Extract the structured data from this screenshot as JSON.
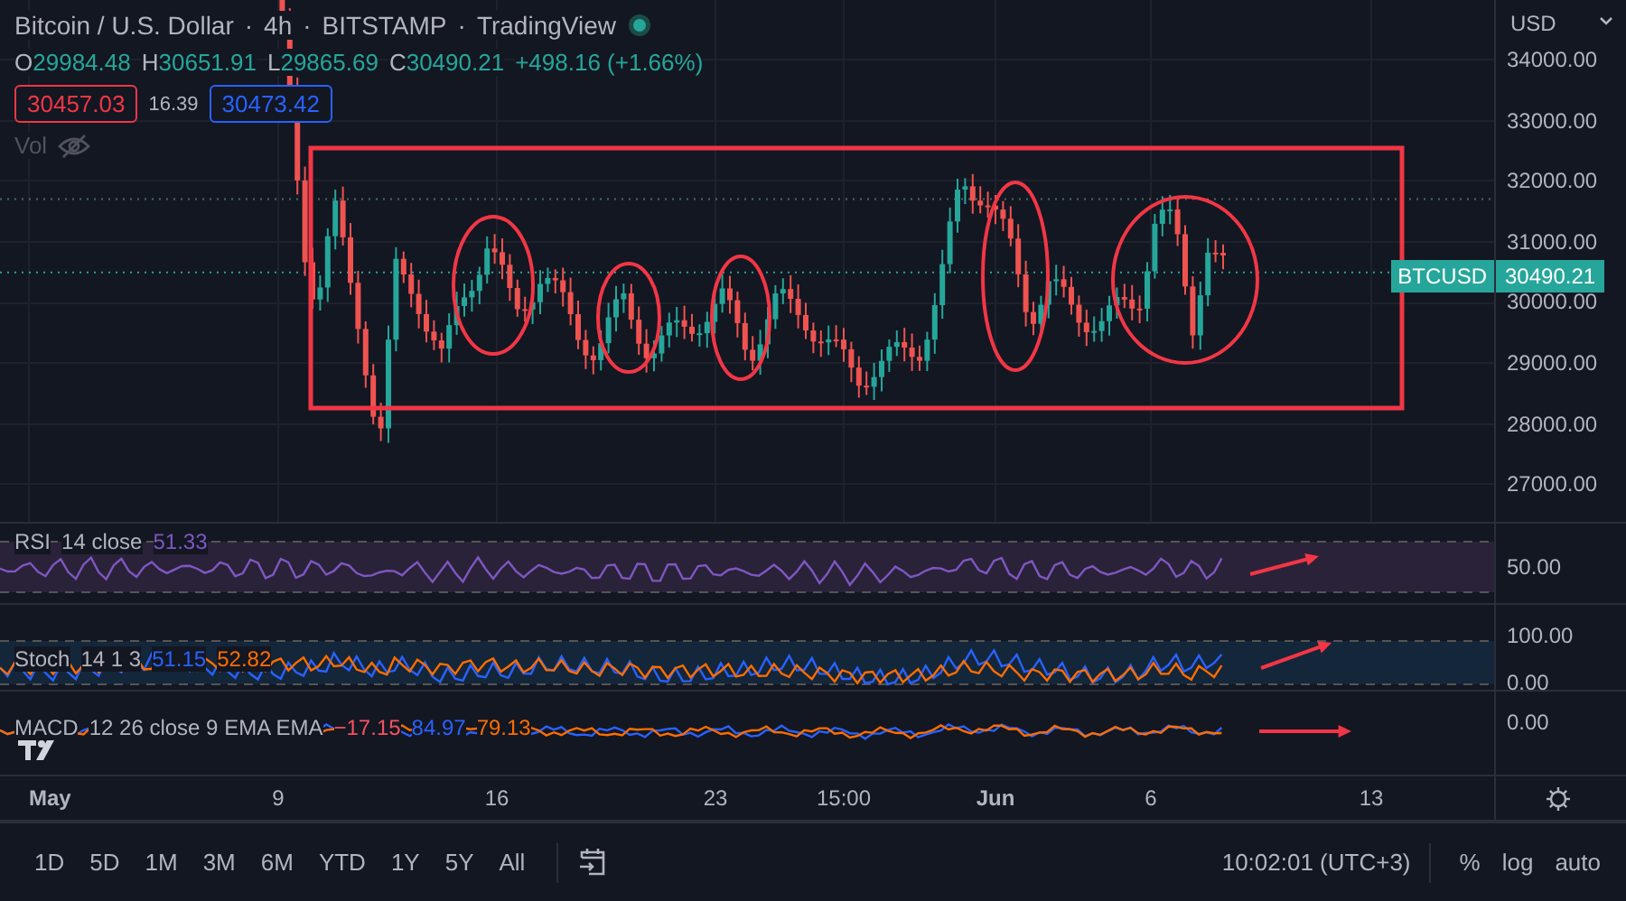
{
  "symbol": {
    "title": "Bitcoin / U.S. Dollar",
    "interval": "4h",
    "exchange": "BITSTAMP",
    "source": "TradingView",
    "separators": [
      "·",
      "·",
      "·"
    ]
  },
  "ohlc": [
    {
      "label": "O",
      "value": "29984.48"
    },
    {
      "label": "H",
      "value": "30651.91"
    },
    {
      "label": "L",
      "value": "29865.69"
    },
    {
      "label": "C",
      "value": "30490.21"
    }
  ],
  "change": "+498.16 (+1.66%)",
  "quotes": [
    {
      "kind": "sell",
      "value": "30457.03"
    },
    {
      "kind": "spread",
      "value": "16.39"
    },
    {
      "kind": "buy",
      "value": "30473.42"
    }
  ],
  "volume": {
    "label": "Vol",
    "hidden": true
  },
  "price_axis": {
    "currency": "USD",
    "ticks": [
      "34000.00",
      "33000.00",
      "32000.00",
      "31000.00",
      "30000.00",
      "29000.00",
      "28000.00",
      "27000.00"
    ],
    "last_price": {
      "symbol": "BTCUSD",
      "value": "30490.21"
    }
  },
  "indicators": [
    {
      "kind": "rsi",
      "name": "RSI",
      "params": "14 close",
      "values": [
        {
          "text": "51.33",
          "color": "#7e57c2"
        }
      ],
      "ticks": [
        "50.00"
      ]
    },
    {
      "kind": "stoch",
      "name": "Stoch",
      "params": "14 1 3",
      "values": [
        {
          "text": "51.15",
          "color": "#2962ff"
        },
        {
          "text": "52.82",
          "color": "#ff6d00"
        }
      ],
      "ticks": [
        "100.00",
        "0.00"
      ]
    },
    {
      "kind": "macd",
      "name": "MACD",
      "params": "12 26 close 9 EMA EMA",
      "values": [
        {
          "text": "−17.15",
          "color": "#f7525f"
        },
        {
          "text": "84.97",
          "color": "#2962ff"
        },
        {
          "text": "79.13",
          "color": "#ff6d00"
        }
      ],
      "ticks": [
        "0.00"
      ]
    }
  ],
  "time_axis": [
    {
      "label": "May",
      "kind": "month"
    },
    {
      "label": "9",
      "kind": "day"
    },
    {
      "label": "16",
      "kind": "day"
    },
    {
      "label": "23",
      "kind": "day"
    },
    {
      "label": "15:00",
      "kind": "time"
    },
    {
      "label": "Jun",
      "kind": "month"
    },
    {
      "label": "6",
      "kind": "day"
    },
    {
      "label": "13",
      "kind": "day"
    }
  ],
  "ranges": [
    {
      "label": "1D",
      "selected": false
    },
    {
      "label": "5D",
      "selected": false
    },
    {
      "label": "1M",
      "selected": false
    },
    {
      "label": "3M",
      "selected": false
    },
    {
      "label": "6M",
      "selected": false
    },
    {
      "label": "YTD",
      "selected": false
    },
    {
      "label": "1Y",
      "selected": false
    },
    {
      "label": "5Y",
      "selected": false
    },
    {
      "label": "All",
      "selected": false
    }
  ],
  "clock": "10:02:01 (UTC+3)",
  "scale_options": [
    "%",
    "log",
    "auto"
  ]
}
